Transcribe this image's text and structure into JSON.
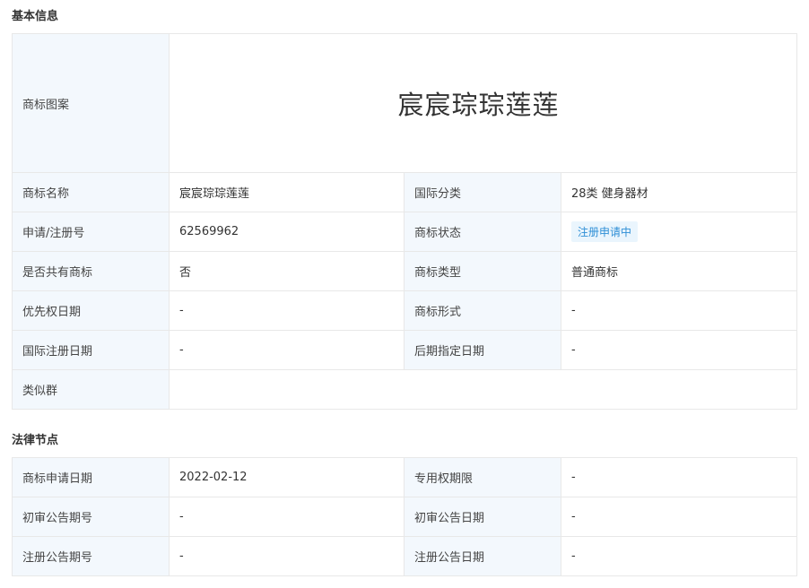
{
  "basic_info": {
    "title": "基本信息",
    "logo_label": "商标图案",
    "logo_text": "宸宸琮琮莲莲",
    "rows": [
      {
        "l1": "商标名称",
        "v1": "宸宸琮琮莲莲",
        "l2": "国际分类",
        "v2": "28类 健身器材"
      },
      {
        "l1": "申请/注册号",
        "v1": "62569962",
        "l2": "商标状态",
        "v2": "注册申请中"
      },
      {
        "l1": "是否共有商标",
        "v1": "否",
        "l2": "商标类型",
        "v2": "普通商标"
      },
      {
        "l1": "优先权日期",
        "v1": "-",
        "l2": "商标形式",
        "v2": "-"
      },
      {
        "l1": "国际注册日期",
        "v1": "-",
        "l2": "后期指定日期",
        "v2": "-"
      }
    ],
    "similar_group_label": "类似群",
    "similar_group_value": ""
  },
  "legal": {
    "title": "法律节点",
    "rows": [
      {
        "l1": "商标申请日期",
        "v1": "2022-02-12",
        "l2": "专用权期限",
        "v2": "-"
      },
      {
        "l1": "初审公告期号",
        "v1": "-",
        "l2": "初审公告日期",
        "v2": "-"
      },
      {
        "l1": "注册公告期号",
        "v1": "-",
        "l2": "注册公告日期",
        "v2": "-"
      }
    ]
  },
  "colors": {
    "label_bg": "#f3f8fd",
    "border": "#e8e8e8",
    "status_bg": "#eaf5fd",
    "status_text": "#2f8fd6"
  }
}
